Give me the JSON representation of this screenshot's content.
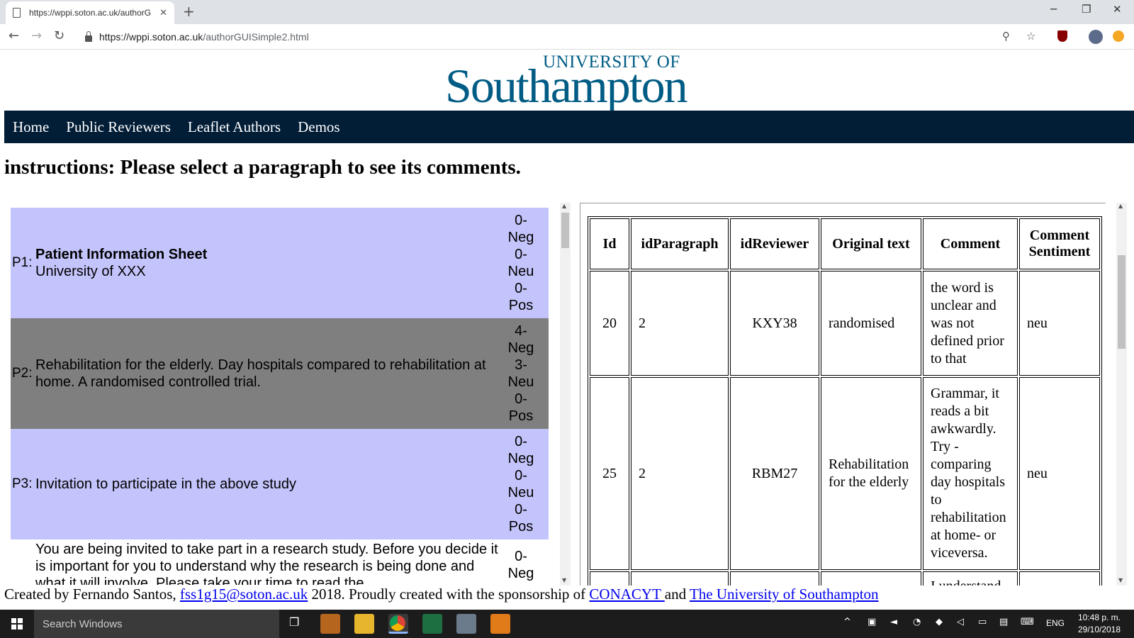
{
  "browser": {
    "tab_title": "https://wppi.soton.ac.uk/authorG",
    "url_host": "https://wppi.soton.ac.uk",
    "url_path": "/authorGUISimple2.html"
  },
  "logo": {
    "line1": "UNIVERSITY OF",
    "line2": "Southampton"
  },
  "nav": [
    "Home",
    "Public Reviewers",
    "Leaflet Authors",
    "Demos"
  ],
  "instructions": "instructions: Please select a paragraph to see its comments.",
  "paragraphs": [
    {
      "id": "P1:",
      "title": "Patient Information Sheet",
      "text": "University of XXX",
      "neg": "0-",
      "neg_label": "Neg",
      "neu": "0-",
      "neu_label": "Neu",
      "pos": "0-",
      "pos_label": "Pos"
    },
    {
      "id": "P2:",
      "title": "",
      "text": "Rehabilitation for the elderly. Day hospitals compared to rehabilitation at home. A randomised controlled trial.",
      "neg": "4-",
      "neg_label": "Neg",
      "neu": "3-",
      "neu_label": "Neu",
      "pos": "0-",
      "pos_label": "Pos"
    },
    {
      "id": "P3:",
      "title": "",
      "text": "Invitation to participate in the above study",
      "neg": "0-",
      "neg_label": "Neg",
      "neu": "0-",
      "neu_label": "Neu",
      "pos": "0-",
      "pos_label": "Pos"
    },
    {
      "id": "",
      "title": "",
      "text": "You are being invited to take part in a research study. Before you decide it is important for you to understand why the research is being done and what it will involve. Please take your time to read the",
      "neg": "0-",
      "neg_label": "Neg",
      "neu": "",
      "neu_label": "",
      "pos": "",
      "pos_label": ""
    }
  ],
  "table": {
    "headers": [
      "Id",
      "idParagraph",
      "idReviewer",
      "Original text",
      "Comment",
      "Comment Sentiment"
    ],
    "rows": [
      [
        "20",
        "2",
        "KXY38",
        "randomised",
        "the word is unclear and was not defined prior to that",
        "neu"
      ],
      [
        "25",
        "2",
        "RBM27",
        "Rehabilitation for the elderly",
        "Grammar, it reads a bit awkwardly. Try - comparing day hospitals to rehabilitation at home- or viceversa.",
        "neu"
      ],
      [
        "",
        "",
        "",
        "",
        "I understand",
        ""
      ]
    ]
  },
  "footer": {
    "prefix": "Created by Fernando Santos, ",
    "email": "fss1g15@soton.ac.uk",
    "mid": " 2018. Proudly created with the sponsorship of ",
    "link1": "CONACYT ",
    "and": " and ",
    "link2": "The University of Southampton "
  },
  "taskbar": {
    "search_placeholder": "Search Windows",
    "lang": "ENG",
    "time": "10:48 p. m.",
    "date": "29/10/2018"
  },
  "colors": {
    "nav_bg": "#021d36",
    "para_bg": "#c4c4fc",
    "para_selected_bg": "#7f7f7f",
    "logo_blue": "#005c84"
  }
}
